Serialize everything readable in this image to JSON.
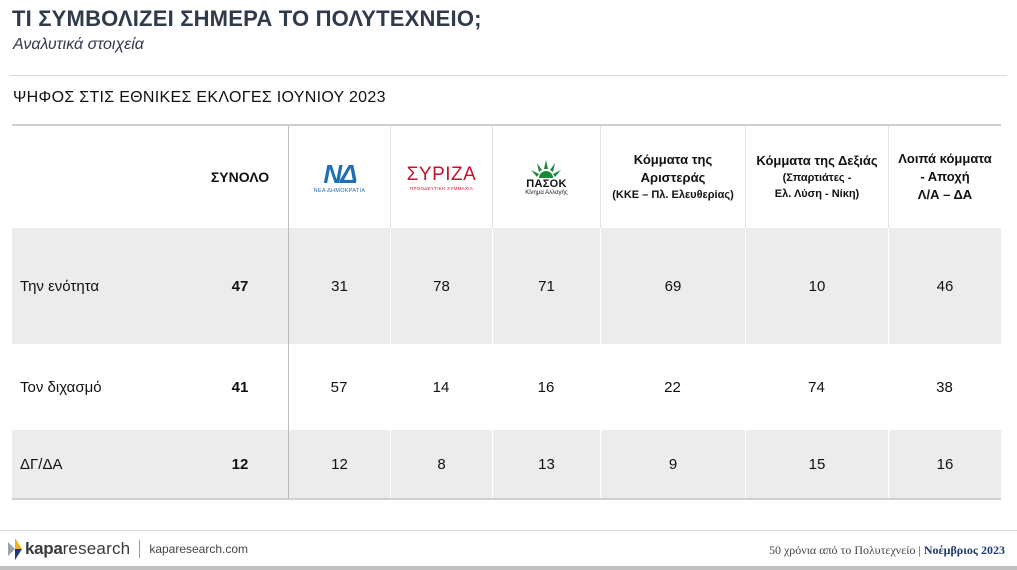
{
  "header": {
    "title": "ΤΙ ΣΥΜΒΟΛΙΖΕΙ ΣΗΜΕΡΑ ΤΟ ΠΟΛΥΤΕΧΝΕΙΟ;",
    "subtitle": "Αναλυτικά στοιχεία"
  },
  "section_title": "ΨΗΦΟΣ ΣΤΙΣ ΕΘΝΙΚΕΣ ΕΚΛΟΓΕΣ ΙΟΥΝΙΟΥ 2023",
  "table": {
    "columns": {
      "total": "ΣΥΝΟΛΟ",
      "nd": {
        "mark": "ΝΔ",
        "sub": "ΝΕΑ ΔΗΜΟΚΡΑΤΙΑ",
        "color": "#1f6fb8"
      },
      "syriza": {
        "mark": "ΣΥΡΙΖΑ",
        "sub": "ΠΡΟΟΔΕΥΤΙΚΗ ΣΥΜΜΑΧΙΑ",
        "color": "#c8102e"
      },
      "pasok": {
        "mark": "ΠΑΣΟΚ",
        "sub": "Κίνημα Αλλαγής",
        "color": "#1a8a3a"
      },
      "left": {
        "line1": "Κόμματα της",
        "line2": "Αριστεράς",
        "line3": "(ΚΚΕ – Πλ. Ελευθερίας)"
      },
      "right": {
        "line1": "Κόμματα της Δεξιάς",
        "line2": "(Σπαρτιάτες -",
        "line3": "Ελ. Λύση - Νίκη)"
      },
      "other": {
        "line1": "Λοιπά κόμματα",
        "line2": "- Αποχή",
        "line3": "Λ/Α – ΔΑ"
      }
    },
    "rows": [
      {
        "label": "Την ενότητα",
        "total": "47",
        "nd": "31",
        "syriza": "78",
        "pasok": "71",
        "left": "69",
        "right": "10",
        "other": "46"
      },
      {
        "label": "Τον διχασμό",
        "total": "41",
        "nd": "57",
        "syriza": "14",
        "pasok": "16",
        "left": "22",
        "right": "74",
        "other": "38"
      },
      {
        "label": "ΔΓ/ΔΑ",
        "total": "12",
        "nd": "12",
        "syriza": "8",
        "pasok": "13",
        "left": "9",
        "right": "15",
        "other": "16"
      }
    ]
  },
  "footer": {
    "brand_kapa": "kapa",
    "brand_research": "research",
    "url": "kaparesearch.com",
    "right_text": "50 χρόνια από το Πολυτεχνείο |",
    "right_date": "Νοέμβριος 2023"
  }
}
